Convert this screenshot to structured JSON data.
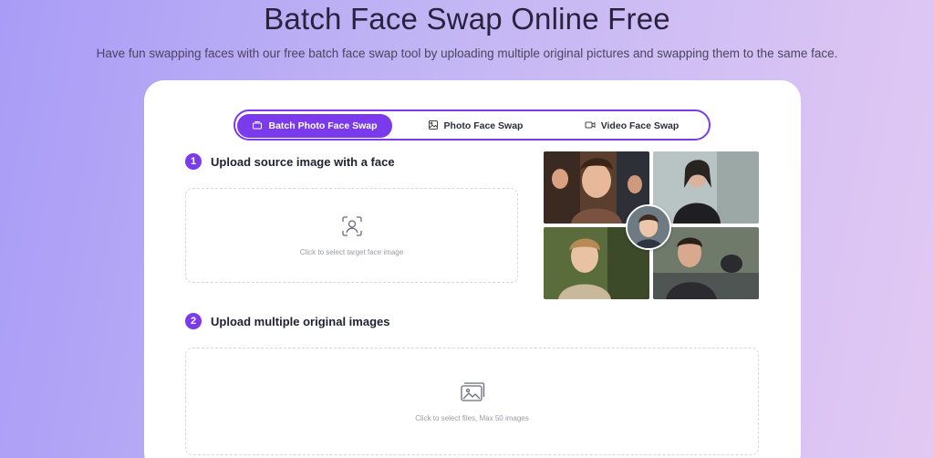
{
  "hero": {
    "title": "Batch Face Swap Online Free",
    "subtitle": "Have fun swapping faces with our free batch face swap tool by uploading multiple original pictures and swapping them to the same face."
  },
  "tabs": [
    {
      "label": "Batch Photo Face Swap",
      "icon": "stack-icon",
      "active": true
    },
    {
      "label": "Photo Face Swap",
      "icon": "image-icon",
      "active": false
    },
    {
      "label": "Video Face Swap",
      "icon": "video-icon",
      "active": false
    }
  ],
  "step1": {
    "number": "1",
    "title": "Upload source image with a face",
    "drop_text": "Click to select target face image",
    "icon": "face-scan-icon"
  },
  "step2": {
    "number": "2",
    "title": "Upload multiple original images",
    "drop_text": "Click to select files, Max 50 images",
    "icon": "images-icon"
  },
  "colors": {
    "accent": "#7c3aed",
    "background_start": "#a99cf6",
    "background_end": "#e2c9f3"
  }
}
